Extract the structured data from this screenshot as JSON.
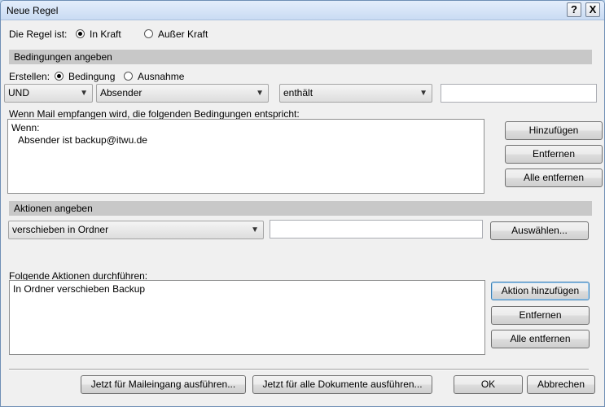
{
  "window": {
    "title": "Neue Regel"
  },
  "titlebar": {
    "help_label": "?",
    "close_label": "X"
  },
  "rule_state": {
    "label": "Die Regel ist:",
    "options": [
      {
        "label": "In Kraft",
        "checked": true
      },
      {
        "label": "Außer Kraft",
        "checked": false
      }
    ]
  },
  "conditions": {
    "header": "Bedingungen angeben",
    "create_label": "Erstellen:",
    "create_options": [
      {
        "label": "Bedingung",
        "checked": true
      },
      {
        "label": "Ausnahme",
        "checked": false
      }
    ],
    "logic_select": "UND",
    "field_select": "Absender",
    "operator_select": "enthält",
    "value_input": "",
    "list_label": "Wenn Mail empfangen wird, die folgenden Bedingungen entspricht:",
    "list_lines": [
      "Wenn:",
      "Absender ist backup@itwu.de"
    ],
    "buttons": {
      "add": "Hinzufügen",
      "remove": "Entfernen",
      "remove_all": "Alle entfernen"
    }
  },
  "actions": {
    "header": "Aktionen angeben",
    "action_select": "verschieben in Ordner",
    "target_input": "",
    "choose_button": "Auswählen...",
    "list_label": "Folgende Aktionen durchführen:",
    "list_lines": [
      "In Ordner verschieben Backup"
    ],
    "buttons": {
      "add": "Aktion hinzufügen",
      "remove": "Entfernen",
      "remove_all": "Alle entfernen"
    }
  },
  "footer": {
    "run_incoming": "Jetzt für Maileingang ausführen...",
    "run_all": "Jetzt für alle Dokumente ausführen...",
    "ok": "OK",
    "cancel": "Abbrechen"
  }
}
